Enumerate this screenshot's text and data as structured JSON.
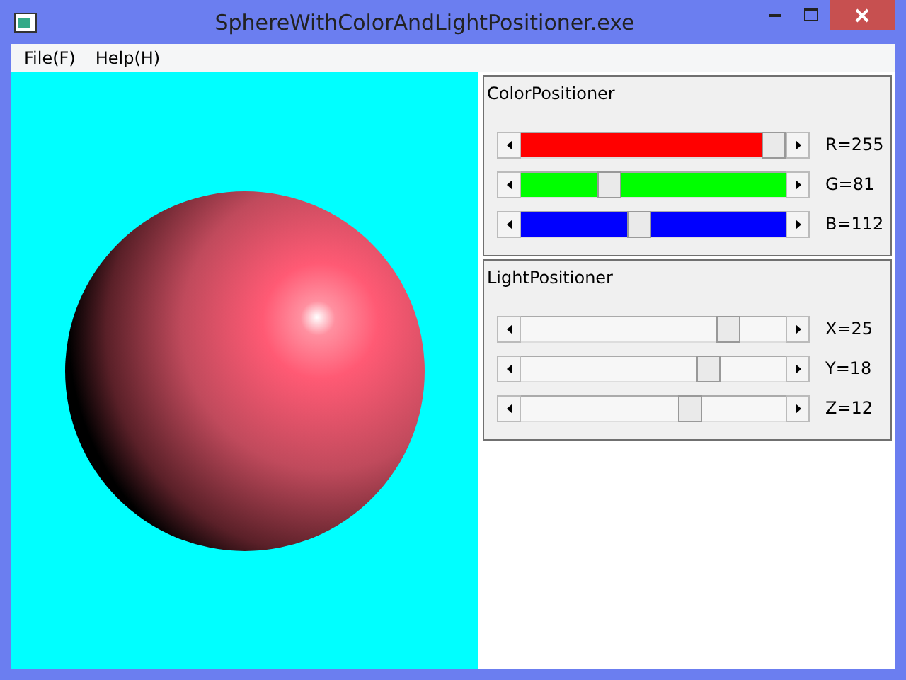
{
  "window": {
    "title": "SphereWithColorAndLightPositioner.exe"
  },
  "menu": [
    "File(F)",
    "Help(H)"
  ],
  "groups": [
    {
      "title": "ColorPositioner",
      "sliders": [
        {
          "label": "R=255",
          "level": 1.0,
          "color": "#ff0000"
        },
        {
          "label": "G=81",
          "level": 0.32,
          "color": "#00ff00"
        },
        {
          "label": "B=112",
          "level": 0.44,
          "color": "#0000ff"
        }
      ]
    },
    {
      "title": "LightPositioner",
      "sliders": [
        {
          "label": "X=25",
          "level": 0.81
        },
        {
          "label": "Y=18",
          "level": 0.73
        },
        {
          "label": "Z=12",
          "level": 0.65
        }
      ]
    }
  ]
}
